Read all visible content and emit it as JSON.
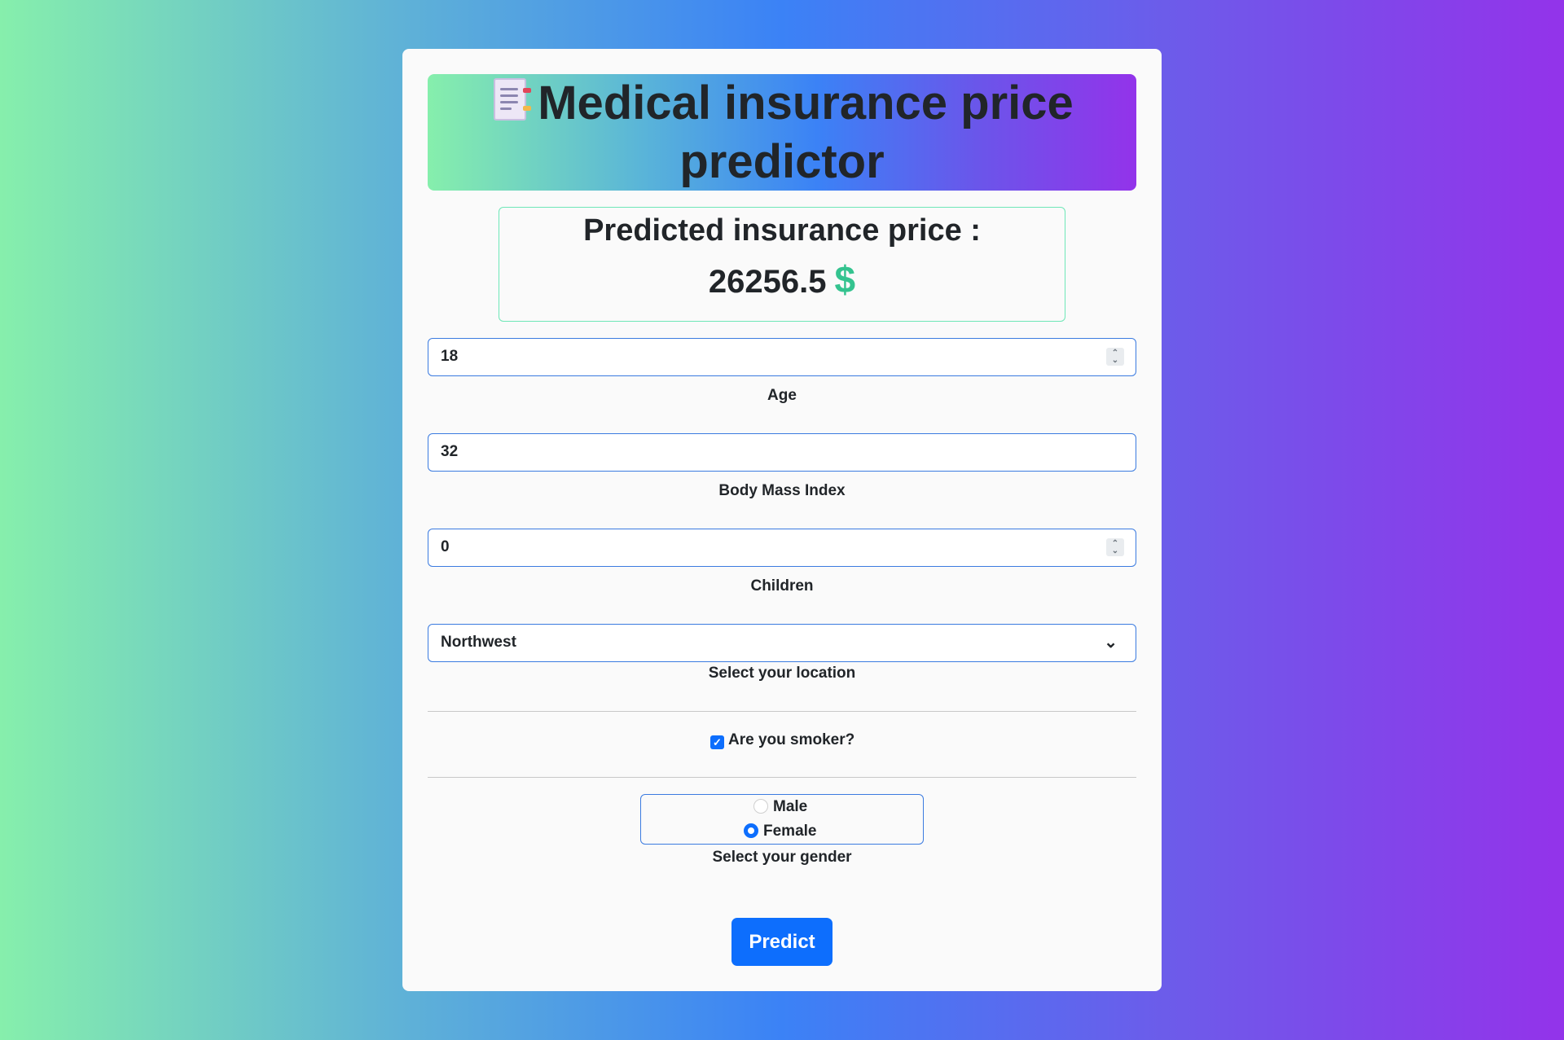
{
  "header": {
    "title_line1": "Medical insurance price",
    "title_line2": "predictor",
    "icon": "document-icon"
  },
  "result": {
    "label": "Predicted insurance price :",
    "value": "26256.5",
    "currency_icon": "$",
    "currency_color": "#34c38f"
  },
  "form": {
    "age": {
      "value": "18",
      "label": "Age"
    },
    "bmi": {
      "value": "32",
      "label": "Body Mass Index"
    },
    "children": {
      "value": "0",
      "label": "Children"
    },
    "location": {
      "selected": "Northwest",
      "label": "Select your location"
    },
    "smoker": {
      "label": "Are you smoker?",
      "checked": true
    },
    "gender": {
      "options": [
        "Male",
        "Female"
      ],
      "selected": "Female",
      "label": "Select your gender"
    },
    "submit_label": "Predict"
  },
  "colors": {
    "accent": "#0d6efd",
    "result_border": "#6ee7b7"
  }
}
